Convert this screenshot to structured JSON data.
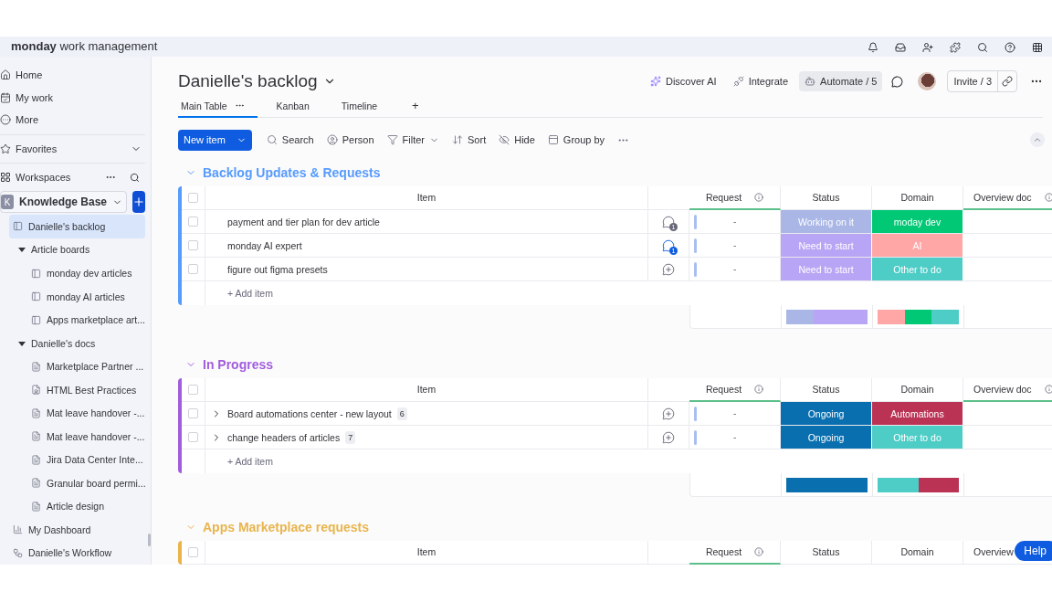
{
  "topbar": {
    "logo": "**monday** work management"
  },
  "sidebar": {
    "nav": [
      {
        "label": "Home",
        "kind": "home"
      },
      {
        "label": "My work",
        "kind": "mywork"
      },
      {
        "label": "More",
        "kind": "more"
      }
    ],
    "favorites": "Favorites",
    "workspaces": "Workspaces",
    "workspace": {
      "initial": "K",
      "name": "Knowledge Base"
    },
    "tree": [
      {
        "label": "Danielle's backlog",
        "kind": "board",
        "selected": true
      },
      {
        "label": "Article boards",
        "kind": "folder",
        "selected": false,
        "expanded": true,
        "children": [
          {
            "label": "monday dev articles",
            "kind": "board",
            "selected": false
          },
          {
            "label": "monday AI articles",
            "kind": "board",
            "selected": false
          },
          {
            "label": "Apps marketplace art...",
            "kind": "board",
            "selected": false
          }
        ]
      },
      {
        "label": "Danielle's docs",
        "kind": "folder",
        "selected": false,
        "expanded": true,
        "children": [
          {
            "label": "Marketplace Partner ...",
            "kind": "doc",
            "selected": false
          },
          {
            "label": "HTML Best Practices",
            "kind": "shared-doc",
            "selected": false
          },
          {
            "label": "Mat leave handover -...",
            "kind": "doc",
            "selected": false
          },
          {
            "label": "Mat leave handover -...",
            "kind": "doc",
            "selected": false
          },
          {
            "label": "Jira Data Center Inte...",
            "kind": "doc",
            "selected": false
          },
          {
            "label": "Granular board permi...",
            "kind": "doc",
            "selected": false
          },
          {
            "label": "Article design",
            "kind": "doc",
            "selected": false
          }
        ]
      },
      {
        "label": "My Dashboard",
        "kind": "dashboard",
        "selected": false
      },
      {
        "label": "Danielle's Workflow",
        "kind": "workflow",
        "selected": false
      }
    ]
  },
  "board": {
    "title": "Danielle's backlog",
    "actions": [
      {
        "label": "Discover AI",
        "kind": "ai",
        "hovered": false
      },
      {
        "label": "Integrate",
        "kind": "integrate",
        "hovered": false
      },
      {
        "label": "Automate / 5",
        "kind": "automate",
        "hovered": true
      }
    ],
    "invite": "Invite / 3",
    "tabs": [
      {
        "label": "Main Table",
        "selected": true
      },
      {
        "label": "Kanban",
        "selected": false
      },
      {
        "label": "Timeline",
        "selected": false
      }
    ],
    "add_tab": "+",
    "new_item": "New item",
    "tools": [
      {
        "label": "Search",
        "kind": "search"
      },
      {
        "label": "Person",
        "kind": "person"
      },
      {
        "label": "Filter",
        "kind": "filter"
      },
      {
        "label": "Sort",
        "kind": "sort"
      },
      {
        "label": "Hide",
        "kind": "hide"
      },
      {
        "label": "Group by",
        "kind": "group"
      }
    ]
  },
  "groups": [
    {
      "title": "Backlog Updates & Requests",
      "color": "#579bfc",
      "checked": false,
      "columns": [
        {
          "label": "Item",
          "info": false
        },
        {
          "label": "Request",
          "info": true
        },
        {
          "label": "Status",
          "info": false
        },
        {
          "label": "Domain",
          "info": false
        },
        {
          "label": "Overview doc",
          "info": true
        }
      ],
      "rows": [
        {
          "name": "payment and tier plan for dev article",
          "checked": false,
          "updates": {
            "kind": "count",
            "count": "1",
            "unread": false
          },
          "request": "-",
          "status": {
            "label": "Working on it",
            "color": "#a9b6e6"
          },
          "domain": {
            "label": "moday dev",
            "color": "#00c875"
          }
        },
        {
          "name": "monday AI expert",
          "checked": false,
          "updates": {
            "kind": "count",
            "count": "1",
            "unread": true
          },
          "request": "-",
          "status": {
            "label": "Need to start",
            "color": "#b9a5f5"
          },
          "domain": {
            "label": "AI",
            "color": "#ffa6a6"
          }
        },
        {
          "name": "figure out figma presets",
          "checked": false,
          "updates": {
            "kind": "add"
          },
          "request": "-",
          "status": {
            "label": "Need to start",
            "color": "#b9a5f5"
          },
          "domain": {
            "label": "Other to do",
            "color": "#4eccc6"
          }
        }
      ],
      "add_item": "+ Add item",
      "summary": {
        "status": [
          {
            "color": "#a9b6e6"
          },
          {
            "color": "#b9a5f5"
          },
          {
            "color": "#b9a5f5"
          }
        ],
        "domain": [
          {
            "color": "#ffa6a6"
          },
          {
            "color": "#00c875"
          },
          {
            "color": "#4eccc6"
          }
        ]
      }
    },
    {
      "title": "In Progress",
      "color": "#a25ddc",
      "checked": false,
      "columns": [
        {
          "label": "Item",
          "info": false
        },
        {
          "label": "Request",
          "info": true
        },
        {
          "label": "Status",
          "info": false
        },
        {
          "label": "Domain",
          "info": false
        },
        {
          "label": "Overview doc",
          "info": true
        }
      ],
      "rows": [
        {
          "name": "Board automations center - new layout",
          "checked": false,
          "subitems": "6",
          "updates": {
            "kind": "add"
          },
          "request": "-",
          "status": {
            "label": "Ongoing",
            "color": "#0a6fae"
          },
          "domain": {
            "label": "Automations",
            "color": "#bb3354"
          }
        },
        {
          "name": "change headers of articles",
          "checked": false,
          "subitems": "7",
          "updates": {
            "kind": "add"
          },
          "request": "-",
          "status": {
            "label": "Ongoing",
            "color": "#0a6fae"
          },
          "domain": {
            "label": "Other to do",
            "color": "#4eccc6"
          }
        }
      ],
      "add_item": "+ Add item",
      "summary": {
        "status": [
          {
            "color": "#0a6fae"
          }
        ],
        "domain": [
          {
            "color": "#4eccc6"
          },
          {
            "color": "#bb3354"
          }
        ]
      }
    },
    {
      "title": "Apps Marketplace requests",
      "color": "#e9b44c",
      "checked": false,
      "columns": [
        {
          "label": "Item",
          "info": false
        },
        {
          "label": "Request",
          "info": true
        },
        {
          "label": "Status",
          "info": false
        },
        {
          "label": "Domain",
          "info": false
        },
        {
          "label": "Overview",
          "info": false
        }
      ]
    }
  ],
  "help": "Help"
}
